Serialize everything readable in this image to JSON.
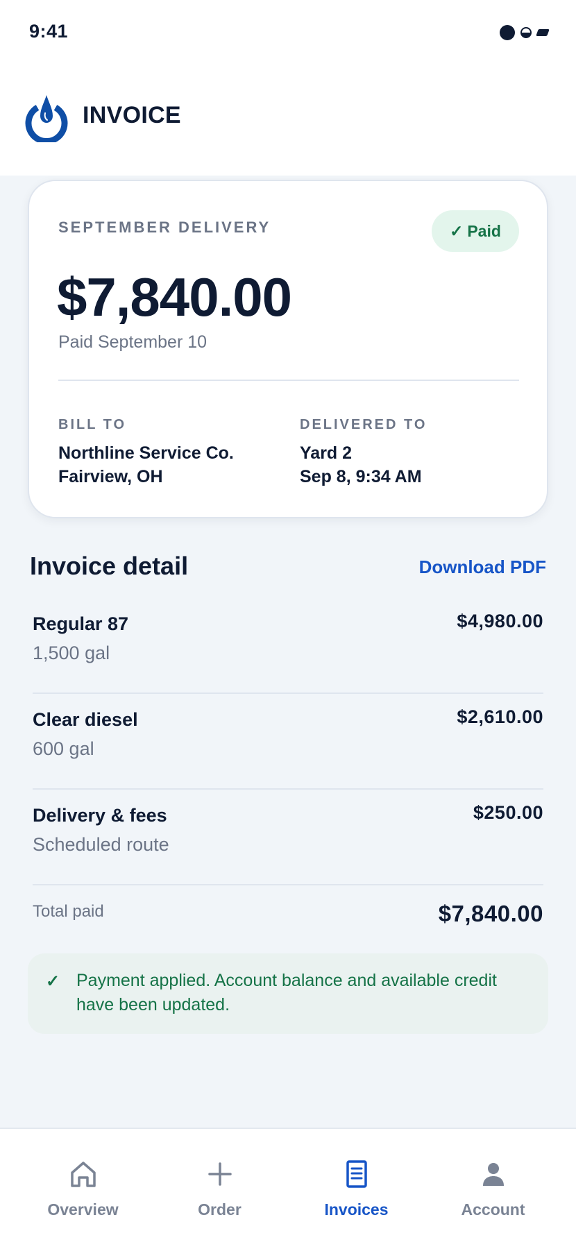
{
  "status_bar": {
    "time": "9:41"
  },
  "header": {
    "title": "INVOICE",
    "logo_icon": "fuel-drop-power-icon"
  },
  "summary_card": {
    "eyebrow": "SEPTEMBER DELIVERY",
    "status_badge": "Paid",
    "amount": "$7,840.00",
    "paid_date": "Paid September 10",
    "bill_to": {
      "label": "BILL TO",
      "name": "Northline Service Co.",
      "location": "Fairview, OH"
    },
    "delivered_to": {
      "label": "DELIVERED TO",
      "site": "Yard 2",
      "datetime": "Sep 8, 9:34 AM"
    }
  },
  "detail": {
    "title": "Invoice detail",
    "download_label": "Download PDF",
    "items": [
      {
        "name": "Regular 87",
        "sub": "1,500 gal",
        "price": "$4,980.00"
      },
      {
        "name": "Clear diesel",
        "sub": "600 gal",
        "price": "$2,610.00"
      },
      {
        "name": "Delivery & fees",
        "sub": "Scheduled route",
        "price": "$250.00"
      }
    ],
    "total_label": "Total paid",
    "total_value": "$7,840.00"
  },
  "notice": {
    "text": "Payment applied. Account balance and available credit have been updated."
  },
  "tabs": [
    {
      "label": "Overview",
      "icon": "home-icon",
      "active": false
    },
    {
      "label": "Order",
      "icon": "plus-icon",
      "active": false
    },
    {
      "label": "Invoices",
      "icon": "document-icon",
      "active": true
    },
    {
      "label": "Account",
      "icon": "person-icon",
      "active": false
    }
  ],
  "colors": {
    "primary": "#1755c7",
    "success": "#157347",
    "success_bg": "#e3f5ec",
    "text": "#0f1b33",
    "muted": "#6b7486",
    "background": "#f1f5f9"
  }
}
